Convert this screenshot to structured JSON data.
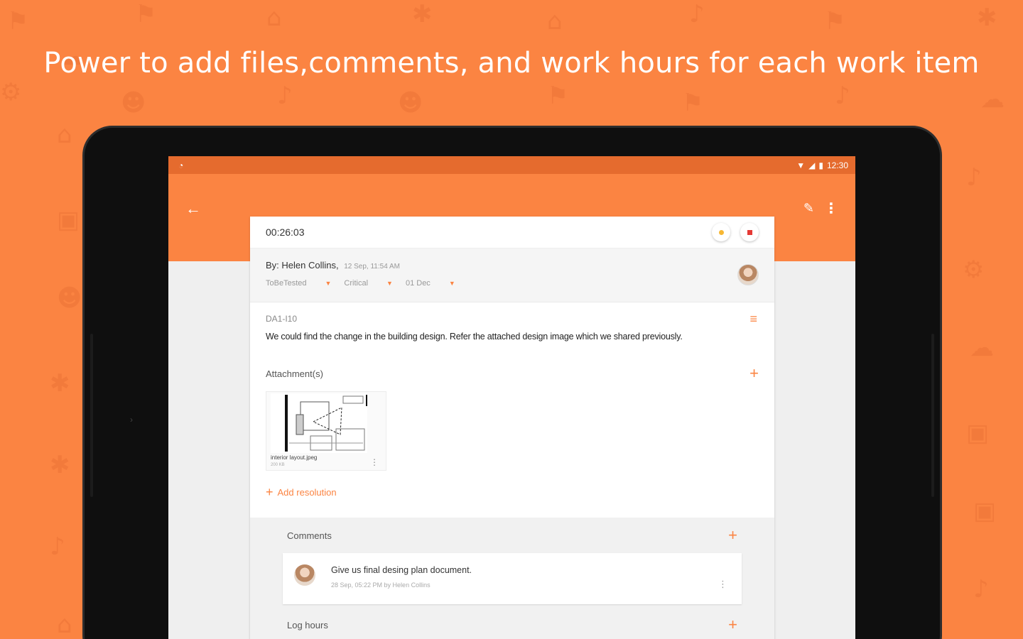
{
  "headline": "Power to add files,comments, and work hours for each work item",
  "statusbar": {
    "time": "12:30"
  },
  "task": {
    "timer": "00:26:03",
    "author": "By: Helen Collins,",
    "created": "12 Sep, 11:54 AM",
    "status": "ToBeTested",
    "priority": "Critical",
    "due": "01 Dec",
    "id": "DA1-I10",
    "description": "We could find the change in the building design. Refer the attached design image which we shared previously.",
    "attachments_label": "Attachment(s)",
    "attachment": {
      "name": "interior layout.jpeg",
      "size": "200 KB"
    },
    "add_resolution_label": "Add resolution"
  },
  "comments": {
    "label": "Comments",
    "items": [
      {
        "text": "Give us final desing plan document.",
        "meta": "28 Sep, 05:22 PM by Helen Collins"
      }
    ]
  },
  "log_hours": {
    "label": "Log hours"
  },
  "colors": {
    "accent": "#FB8442",
    "statusbar": "#E56B2E"
  },
  "icons": {
    "back": "arrow-left-icon",
    "edit": "pencil-icon",
    "more": "more-vert-icon",
    "start": "play-icon",
    "stop": "stop-icon",
    "menu": "menu-icon",
    "add": "plus-icon"
  }
}
